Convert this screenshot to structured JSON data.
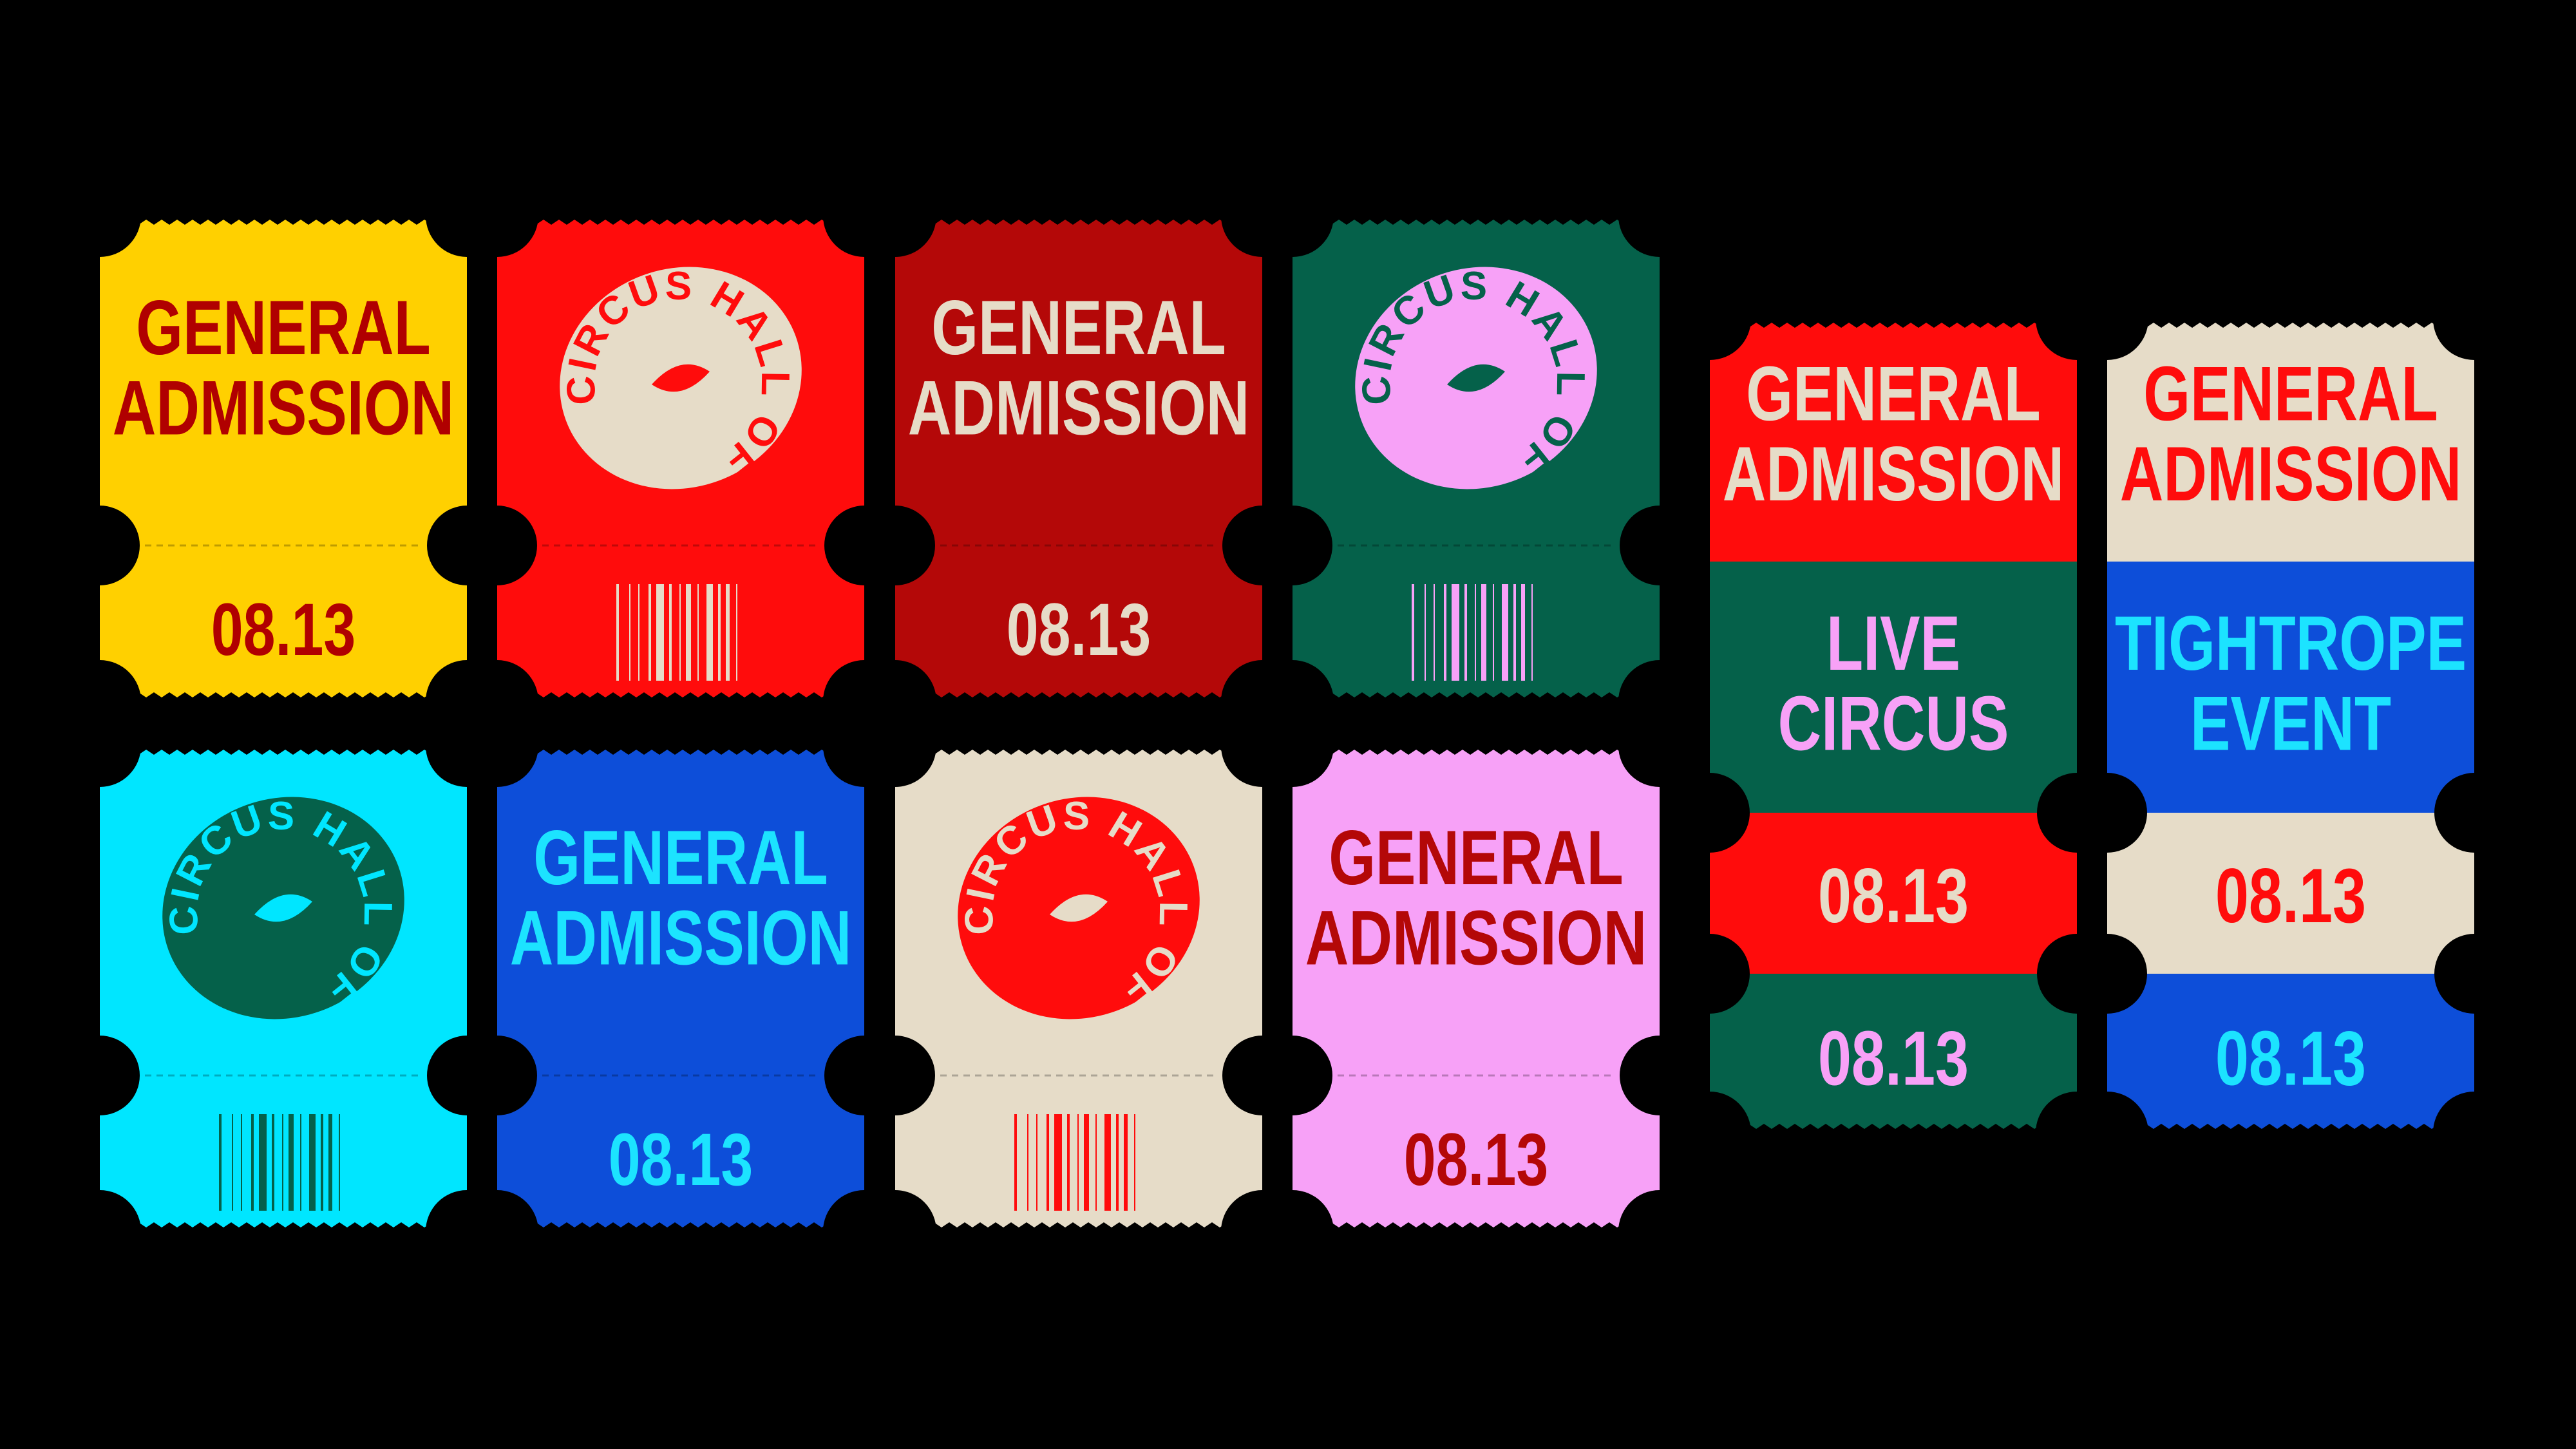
{
  "colors": {
    "background": "#000000",
    "yellow": "#ffd000",
    "red": "#ff0c0c",
    "crimson": "#b00000",
    "darkred": "#b40808",
    "green": "#05614a",
    "pink": "#f7a1f7",
    "cyan": "#00e6ff",
    "blue": "#0d4ed9",
    "lightblue": "#1ce3ff",
    "cream": "#e6dcc8"
  },
  "text": {
    "general": "GENERAL",
    "admission": "ADMISSION",
    "date": "08.13",
    "seal_text": "CIRCUS HALL OF FAME",
    "live": "LIVE",
    "circus": "CIRCUS",
    "tightrope": "TIGHTROPE",
    "event": "EVENT"
  },
  "small_tickets": [
    {
      "id": "ticket-1",
      "bg": "#ffd000",
      "top": {
        "type": "title"
      },
      "top_color": "#b00000",
      "bottom": {
        "type": "date"
      },
      "bottom_color": "#b00000"
    },
    {
      "id": "ticket-2",
      "bg": "#ff0c0c",
      "top": {
        "type": "seal"
      },
      "seal_bg": "#e6dcc8",
      "seal_text_color": "#ff0c0c",
      "bottom": {
        "type": "barcode"
      },
      "bottom_color": "#e6dcc8"
    },
    {
      "id": "ticket-3",
      "bg": "#b40808",
      "top": {
        "type": "title"
      },
      "top_color": "#e6dcc8",
      "bottom": {
        "type": "date"
      },
      "bottom_color": "#e6dcc8"
    },
    {
      "id": "ticket-4",
      "bg": "#05614a",
      "top": {
        "type": "seal"
      },
      "seal_bg": "#f7a1f7",
      "seal_text_color": "#05614a",
      "bottom": {
        "type": "barcode"
      },
      "bottom_color": "#f7a1f7"
    },
    {
      "id": "ticket-5",
      "bg": "#00e6ff",
      "top": {
        "type": "seal"
      },
      "seal_bg": "#05614a",
      "seal_text_color": "#00e6ff",
      "bottom": {
        "type": "barcode"
      },
      "bottom_color": "#05614a"
    },
    {
      "id": "ticket-6",
      "bg": "#0d4ed9",
      "top": {
        "type": "title"
      },
      "top_color": "#1ce3ff",
      "bottom": {
        "type": "date"
      },
      "bottom_color": "#1ce3ff"
    },
    {
      "id": "ticket-7",
      "bg": "#e6dcc8",
      "top": {
        "type": "seal"
      },
      "seal_bg": "#ff0c0c",
      "seal_text_color": "#e6dcc8",
      "bottom": {
        "type": "barcode"
      },
      "bottom_color": "#ff0c0c"
    },
    {
      "id": "ticket-8",
      "bg": "#f7a1f7",
      "top": {
        "type": "title"
      },
      "top_color": "#b40808",
      "bottom": {
        "type": "date"
      },
      "bottom_color": "#b40808"
    }
  ],
  "tall_tickets": [
    {
      "id": "ticket-9",
      "bands": [
        {
          "bg": "#ff0c0c",
          "color": "#e6dcc8",
          "l1": "general",
          "l2": "admission"
        },
        {
          "bg": "#05614a",
          "color": "#f7a1f7",
          "l1": "live",
          "l2": "circus"
        },
        {
          "bg": "#ff0c0c",
          "color": "#e6dcc8",
          "l1": "date"
        },
        {
          "bg": "#05614a",
          "color": "#f7a1f7",
          "l1": "date"
        }
      ]
    },
    {
      "id": "ticket-10",
      "bands": [
        {
          "bg": "#e6dcc8",
          "color": "#ff0c0c",
          "l1": "general",
          "l2": "admission"
        },
        {
          "bg": "#0d4ed9",
          "color": "#1ce3ff",
          "l1": "tightrope",
          "l2": "event"
        },
        {
          "bg": "#e6dcc8",
          "color": "#ff0c0c",
          "l1": "date"
        },
        {
          "bg": "#0d4ed9",
          "color": "#1ce3ff",
          "l1": "date"
        }
      ]
    }
  ]
}
